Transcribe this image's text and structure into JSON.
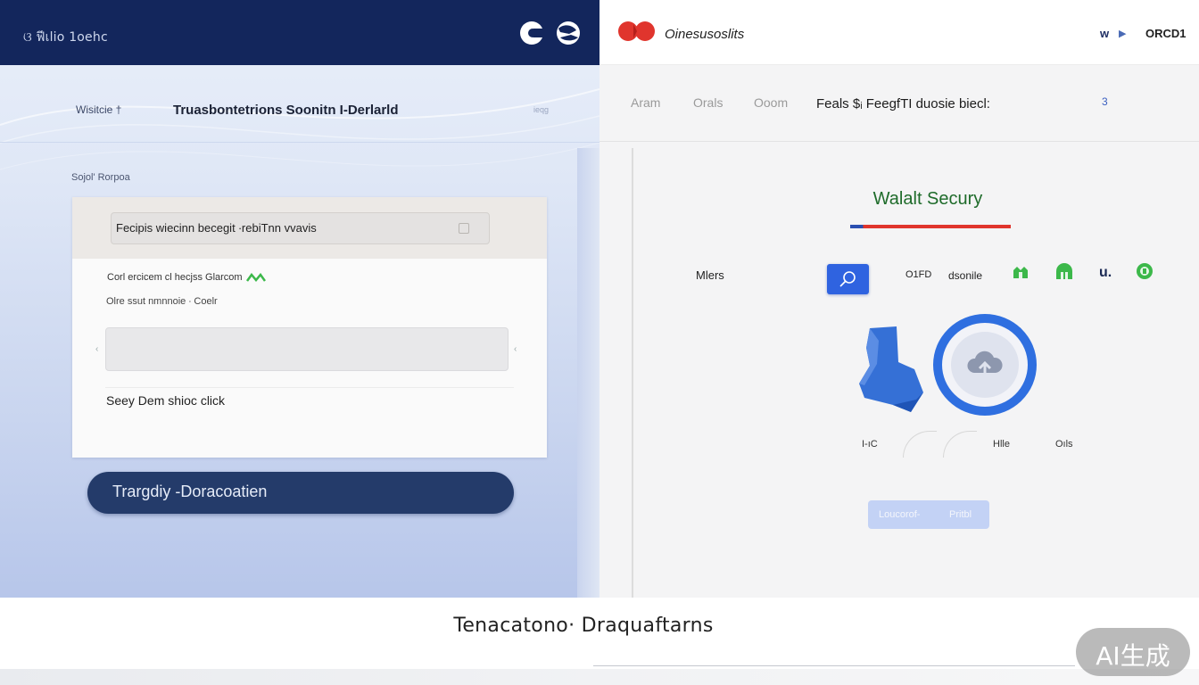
{
  "left_app": {
    "title": "ଓ ฟีเlio ⁠1oehc",
    "logo_text": "CS"
  },
  "left_subnav": {
    "nav_link": "Wisitcie †",
    "heading": "Truasbontetrions Soonitn I-Derlarld",
    "corner_text": "ieqg"
  },
  "form": {
    "section_label": "Sojol' Rorpoa",
    "search_text": "Fecipis wiecinn becegit ∙rebiTnn vvavis",
    "line1": "Corl ercicem cl hecjss Glarcom",
    "line2": "Olre ssut nmnnoie ∙ Coelr",
    "arrow_left": "‹",
    "arrow_right": "‹",
    "input_value": "",
    "hint": "Seey Dem shioc click",
    "primary_button": "Trargdiy -Doracoatien"
  },
  "right_app": {
    "brand_name": "Oinesusoslits",
    "user": "w",
    "user_arrow": "▶",
    "order": "ORCD1",
    "tabs": [
      "Aram",
      "Orals",
      "Ooom"
    ],
    "active_tab": "Feals $ᵢ FeegfTI duosie biecl:",
    "tab_number": "3"
  },
  "wallet": {
    "title": "Walalt Secury",
    "option_label": "Mlers",
    "code": "O1FD",
    "mode": "dsonile",
    "u_label": "u.",
    "captions": [
      "I-ıC",
      "Hlle",
      "Oıls"
    ],
    "pill_left": "Loucorof-",
    "pill_right": "Pritbl"
  },
  "caption": {
    "text": "Tenacatono· Draquaftarns"
  },
  "watermark": {
    "text": "AI生成"
  },
  "colors": {
    "left_topbar": "#13265c",
    "primary_button": "#243b6a",
    "accent_blue": "#2f63e0",
    "wallet_title_green": "#1e6b2a",
    "accent_red": "#e0352d",
    "status_green": "#3cb84a"
  }
}
